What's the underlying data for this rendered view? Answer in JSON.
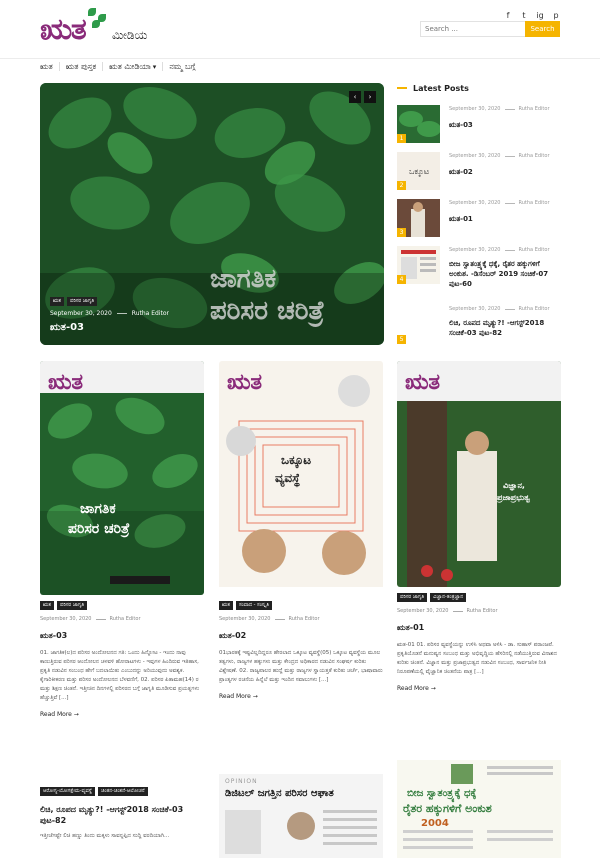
{
  "brand": {
    "logo_main": "ಋತ",
    "logo_sub": "ಮೀಡಿಯ"
  },
  "social": [
    "f",
    "t",
    "ig",
    "p"
  ],
  "search": {
    "placeholder": "Search ...",
    "button": "Search"
  },
  "nav": {
    "items": [
      "ಋತ",
      "ಋತ ಪುಸ್ತಕ",
      "ಋತ ಮೀಡಿಯಾ",
      "ನಮ್ಮ ಬಗ್ಗೆ"
    ],
    "dropdown_caret": "▾"
  },
  "hero": {
    "tags": [
      "ಋತ",
      "ಪರಿಸರ ಜಾಗೃತಿ"
    ],
    "date": "September 30, 2020",
    "author": "Rutha Editor",
    "title": "ಋತ-03",
    "art_line1": "ಜಾಗತಿಕ",
    "art_line2": "ಪರಿಸರ ಚರಿತ್ರೆ",
    "prev": "‹",
    "next": "›"
  },
  "latest": {
    "heading": "Latest Posts",
    "items": [
      {
        "num": "1",
        "date": "September 30, 2020",
        "author": "Rutha Editor",
        "title": "ಋತ-03"
      },
      {
        "num": "2",
        "date": "September 30, 2020",
        "author": "Rutha Editor",
        "title": "ಋತ-02"
      },
      {
        "num": "3",
        "date": "September 30, 2020",
        "author": "Rutha Editor",
        "title": "ಋತ-01"
      },
      {
        "num": "4",
        "date": "September 30, 2020",
        "author": "Rutha Editor",
        "title": "ಬೀಜ ಸ್ವಾತಂತ್ರ್ಯಕ್ಕೆ ಧಕ್ಕೆ, ರೈತರ ಹಕ್ಕುಗಳಿಗೆ ಅಂಕುಶ. -ಡಿಸೆಂಬರ್ 2019 ಸಂಚಿಕೆ-07 ಪುಟ-60"
      },
      {
        "num": "5",
        "date": "September 30, 2020",
        "author": "Rutha Editor",
        "title": "ಲಿಚಿ, ರೂಪದ ಮೃತ್ಯು?! -ಆಗಸ್ಟ್2018 ಸಂಚಿಕೆ-03 ಪುಟ-82"
      }
    ]
  },
  "cards": [
    {
      "tags": [
        "ಋತ",
        "ಪರಿಸರ ಜಾಗೃತಿ"
      ],
      "date": "September 30, 2020",
      "author": "Rutha Editor",
      "title": "ಋತ-03",
      "cover_title_1": "ಜಾಗತಿಕ",
      "cover_title_2": "ಪರಿಸರ ಚರಿತ್ರೆ",
      "excerpt": "01. ಜಾಗತಿಕ(ಲ)ದ ಪರಿಸರ ಅಂದೋಲನದ ಗತಿ: ಒಂದು ಹಿನ್ನೋಟ - ಇಂದು ನಾವು ಕಾಣುತ್ತಿರುವ ಪರಿಸರ ಆಂದೋಲನ ಚಳವಳಿ ಹೋರಾಟಗಳು - ಇವುಗಳ ಹಿಂದಿರುವ ಇತಿಹಾಸ, ಪ್ರಕೃತಿ ನಡುವಿನ ಸಂಬಂಧ ಹೇಗೆ ಬದಲಾಯಿತು ಎಂಬುದನ್ನು ಅರಿಯುವುದು ಅವಶ್ಯಕ. ಕೈಗಾರಿಕೀಕರಣ ಮತ್ತು ಪರಿಸರ ಅಂದೋಲನದ ಬೆಳವಣಿಗೆ, 02. ಪರಿಸರ ಪಿತಾಮಹ(14) ರ ಮತ್ತು ಶಿಕ್ಷಣ ಚಿಂತನೆ. ಇತ್ತೀಚಿನ ದಿನಗಳಲ್ಲಿ ಪರಿಸರದ ಬಗ್ಗೆ ಜಾಗೃತಿ ಮೂಡಿಸುವ ಪ್ರಯತ್ನಗಳು ಹೆಚ್ಚುತ್ತಿವೆ [...]",
      "read_more": "Read More"
    },
    {
      "tags": [
        "ಋತ",
        "ಸಂವಾದ - ಸಂಸ್ಕೃತಿ"
      ],
      "date": "September 30, 2020",
      "author": "Rutha Editor",
      "title": "ಋತ-02",
      "cover_title_1": "ಒಕ್ಕೂಟ",
      "cover_title_2": "ವ್ಯವಸ್ಥೆ",
      "excerpt": "01ಭಾರತಕ್ಕೆ ಇಷ್ಟವಿಲ್ಲದಿದ್ದರೂ ಹೇರಲಾದ ಒಕ್ಕೂಟ ವ್ಯವಸ್ಥೆ(05) ಒಕ್ಕೂಟ ವ್ಯವಸ್ಥೆಯ ಮೂಲ ತತ್ವಗಳು, ರಾಜ್ಯಗಳ ಹಕ್ಕುಗಳು ಮತ್ತು ಕೇಂದ್ರದ ಅಧಿಕಾರದ ನಡುವಿನ ಸಂಘರ್ಷ ಕುರಿತು ವಿಶ್ಲೇಷಣೆ. 02. ರಾಜ್ಯಪಾಲರ ಹುದ್ದೆ ಮತ್ತು ರಾಜ್ಯಗಳ ಸ್ವಾಯತ್ತತೆ ಕುರಿತು ಚರ್ಚೆ, ಭಾಷಾವಾರು ಪ್ರಾಂತ್ಯಗಳ ರಚನೆಯ ಹಿನ್ನೆಲೆ ಮತ್ತು ಇಂದಿನ ಸವಾಲುಗಳು [...]",
      "read_more": "Read More"
    },
    {
      "tags": [
        "ಪರಿಸರ ಜಾಗೃತಿ",
        "ವಿಜ್ಞಾನ-ತಂತ್ರಜ್ಞಾನ"
      ],
      "date": "September 30, 2020",
      "author": "Rutha Editor",
      "title": "ಋತ-01",
      "cover_title_1": "ವಿಜ್ಞಾನ,",
      "cover_title_2": "ಪ್ರಜಾಪ್ರಭುತ್ವ",
      "excerpt": "ಋತ-01 01. ಪರಿಸರ ವ್ಯವಸ್ಥೆಯನ್ನು ಉಳಿಸಿ ಅಥವಾ ಅಳಿಸಿ - ಡಾ. ಸುಹಾಸ್ ಪರಾಂಜಪೆ. ಪ್ರಕೃತಿಯೊಡನೆ ಮನುಷ್ಯನ ಸಂಬಂಧ ಮತ್ತು ಅಭಿವೃದ್ಧಿಯ ಹೆಸರಿನಲ್ಲಿ ನಡೆಯುತ್ತಿರುವ ವಿನಾಶದ ಕುರಿತು ಚಿಂತನೆ. ವಿಜ್ಞಾನ ಮತ್ತು ಪ್ರಜಾಪ್ರಭುತ್ವದ ನಡುವಿನ ಸಂಬಂಧ, ಸಾರ್ವಜನಿಕ ನೀತಿ ನಿರೂಪಣೆಯಲ್ಲಿ ವೈಜ್ಞಾನಿಕ ಚಿಂತನೆಯ ಪಾತ್ರ [...]",
      "read_more": "Read More"
    }
  ],
  "bottom": {
    "left_tags": [
      "ಆರೋಗ್ಯ-ಯೋಗಕ್ಷೇಮ-ವ್ಯವಸ್ಥೆ",
      "ಚಿಂತನ-ಚಿಂತನೆ-ಆಲೋಚನೆ"
    ],
    "left_title": "ಲಿಚಿ, ರೂಪದ ಮೃತ್ಯು?! -ಆಗಸ್ಟ್2018 ಸಂಚಿಕೆ-03 ಪುಟ-82",
    "left_excerpt": "ಇತ್ತೀಚೆಗಷ್ಟೇ ಲಿಚಿ ಹಣ್ಣು ತಿಂದು ಮಕ್ಕಳು ಸಾವನ್ನಪ್ಪಿದ ಸುದ್ದಿ ವರದಿಯಾಗಿ...",
    "mid_label": "OPINION",
    "mid_title": "ಡಿಜಿಟಲ್ ಜಗತ್ತಿನ ಪರಿಸರ ಆಘಾತ",
    "right_title_1": "ಬೀಜ ಸ್ವಾತಂತ್ರ್ಯಕ್ಕೆ ಧಕ್ಕೆ",
    "right_title_2": "ರೈತರ ಹಕ್ಕುಗಳಿಗೆ ಅಂಕುಶ",
    "right_year": "2004"
  },
  "colors": {
    "accent": "#f5b400",
    "brand": "#8a2b7a",
    "leaf": "#2e9b4a"
  }
}
